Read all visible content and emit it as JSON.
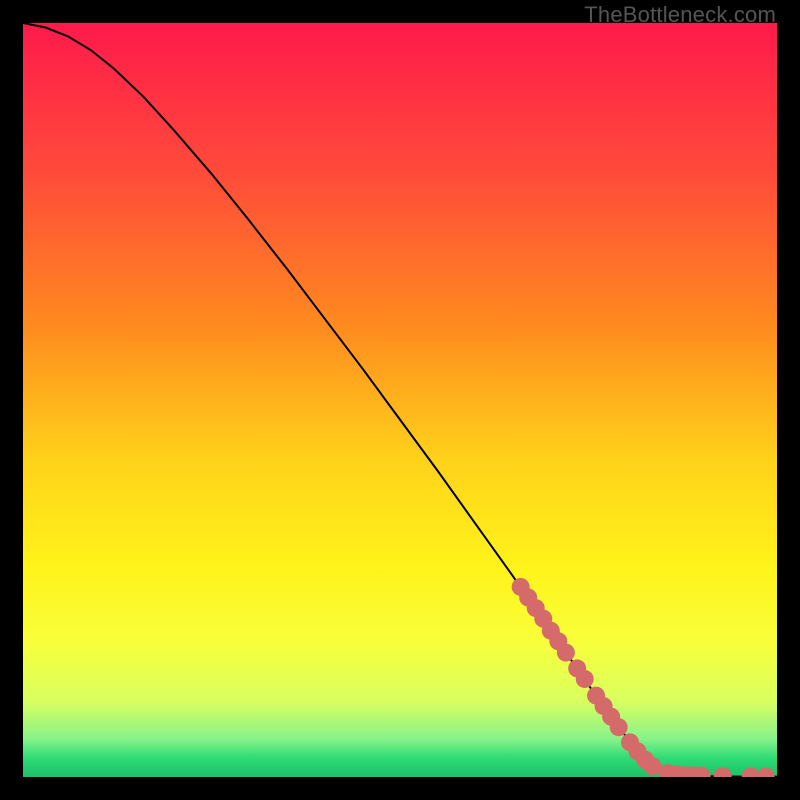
{
  "watermark": "TheBottleneck.com",
  "chart_data": {
    "type": "line",
    "title": "",
    "xlabel": "",
    "ylabel": "",
    "xlim": [
      0,
      100
    ],
    "ylim": [
      0,
      100
    ],
    "gradient_stops": [
      {
        "offset": 0.0,
        "color": "#ff1a4b"
      },
      {
        "offset": 0.2,
        "color": "#ff4b3a"
      },
      {
        "offset": 0.4,
        "color": "#ff8a1f"
      },
      {
        "offset": 0.58,
        "color": "#ffd21a"
      },
      {
        "offset": 0.72,
        "color": "#fff31a"
      },
      {
        "offset": 0.82,
        "color": "#f8ff3a"
      },
      {
        "offset": 0.9,
        "color": "#d8ff60"
      },
      {
        "offset": 0.95,
        "color": "#86f28a"
      },
      {
        "offset": 0.975,
        "color": "#2ddb74"
      },
      {
        "offset": 1.0,
        "color": "#1fbf6a"
      }
    ],
    "curve": [
      {
        "x": 0.0,
        "y": 100.0
      },
      {
        "x": 3.0,
        "y": 99.4
      },
      {
        "x": 6.0,
        "y": 98.2
      },
      {
        "x": 9.0,
        "y": 96.4
      },
      {
        "x": 12.0,
        "y": 94.0
      },
      {
        "x": 16.0,
        "y": 90.2
      },
      {
        "x": 20.0,
        "y": 85.8
      },
      {
        "x": 25.0,
        "y": 80.0
      },
      {
        "x": 30.0,
        "y": 73.8
      },
      {
        "x": 35.0,
        "y": 67.4
      },
      {
        "x": 40.0,
        "y": 60.8
      },
      {
        "x": 45.0,
        "y": 54.2
      },
      {
        "x": 50.0,
        "y": 47.4
      },
      {
        "x": 55.0,
        "y": 40.6
      },
      {
        "x": 60.0,
        "y": 33.6
      },
      {
        "x": 65.0,
        "y": 26.6
      },
      {
        "x": 70.0,
        "y": 19.4
      },
      {
        "x": 75.0,
        "y": 12.2
      },
      {
        "x": 78.0,
        "y": 8.0
      },
      {
        "x": 81.0,
        "y": 4.0
      },
      {
        "x": 83.0,
        "y": 1.8
      },
      {
        "x": 85.0,
        "y": 0.6
      },
      {
        "x": 87.0,
        "y": 0.2
      },
      {
        "x": 90.0,
        "y": 0.1
      },
      {
        "x": 95.0,
        "y": 0.05
      },
      {
        "x": 100.0,
        "y": 0.05
      }
    ],
    "markers": [
      {
        "x": 66.0,
        "y": 25.2
      },
      {
        "x": 67.0,
        "y": 23.8
      },
      {
        "x": 68.0,
        "y": 22.4
      },
      {
        "x": 69.0,
        "y": 21.0
      },
      {
        "x": 70.0,
        "y": 19.4
      },
      {
        "x": 71.0,
        "y": 18.0
      },
      {
        "x": 72.0,
        "y": 16.5
      },
      {
        "x": 73.5,
        "y": 14.4
      },
      {
        "x": 74.5,
        "y": 13.0
      },
      {
        "x": 76.0,
        "y": 10.8
      },
      {
        "x": 77.0,
        "y": 9.4
      },
      {
        "x": 78.0,
        "y": 8.0
      },
      {
        "x": 79.0,
        "y": 6.6
      },
      {
        "x": 80.5,
        "y": 4.6
      },
      {
        "x": 81.5,
        "y": 3.4
      },
      {
        "x": 82.5,
        "y": 2.3
      },
      {
        "x": 83.5,
        "y": 1.4
      },
      {
        "x": 85.5,
        "y": 0.5
      },
      {
        "x": 86.5,
        "y": 0.35
      },
      {
        "x": 87.5,
        "y": 0.25
      },
      {
        "x": 88.3,
        "y": 0.2
      },
      {
        "x": 89.2,
        "y": 0.18
      },
      {
        "x": 90.0,
        "y": 0.15
      },
      {
        "x": 92.8,
        "y": 0.1
      },
      {
        "x": 96.5,
        "y": 0.08
      },
      {
        "x": 98.5,
        "y": 0.07
      }
    ],
    "marker_color": "#d46a6a",
    "marker_radius_px": 9
  }
}
